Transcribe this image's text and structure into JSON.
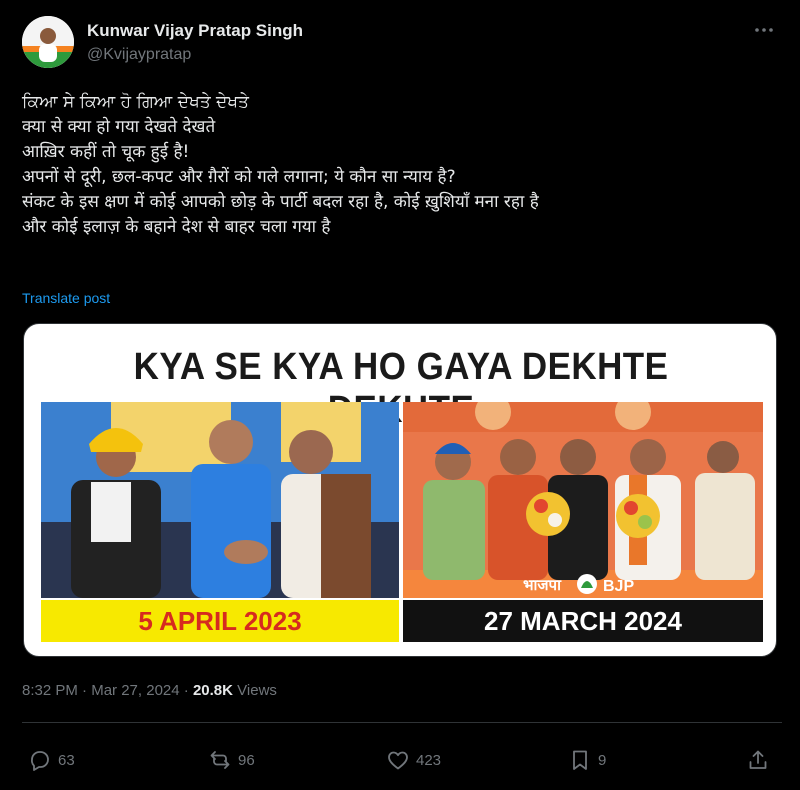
{
  "author": {
    "name": "Kunwar Vijay Pratap Singh",
    "handle": "@Kvijaypratap"
  },
  "post": {
    "lines": [
      "ਕਿਆ ਸੇ ਕਿਆ ਹੋ ਗਿਆ ਦੇਖਤੇ ਦੇਖਤੇ",
      "क्या से क्या हो गया देखते देखते",
      "आख़िर कहीं तो चूक हुई है!",
      "अपनों से दूरी, छल-कपट और ग़ैरों को गले लगाना; ये कौन सा न्याय है?",
      "संकट के इस क्षण में कोई आपको छोड़ के पार्टी बदल रहा है, कोई ख़ुशियाँ मना रहा है",
      "और कोई इलाज़ के बहाने देश से बाहर चला गया है"
    ],
    "translate_label": "Translate post"
  },
  "media": {
    "headline": "KYA SE KYA HO GAYA DEKHTE DEKHTE",
    "left_date": "5 APRIL 2023",
    "right_date": "27 MARCH 2024",
    "right_banner": "भाजपा",
    "right_banner_bjp": "BJP",
    "colors": {
      "left_date_bg": "#f7e900",
      "left_date_text": "#d62b1f",
      "right_date_bg": "#111111",
      "aap_blue": "#2f7fd6",
      "bjp_orange": "#f07b26"
    }
  },
  "meta": {
    "time": "8:32 PM",
    "separator": "·",
    "date": "Mar 27, 2024",
    "views_count": "20.8K",
    "views_label": "Views"
  },
  "actions": {
    "reply_count": "63",
    "repost_count": "96",
    "like_count": "423",
    "bookmark_count": "9"
  },
  "icons": [
    "more-icon",
    "reply-icon",
    "repost-icon",
    "like-icon",
    "bookmark-icon",
    "share-icon"
  ]
}
